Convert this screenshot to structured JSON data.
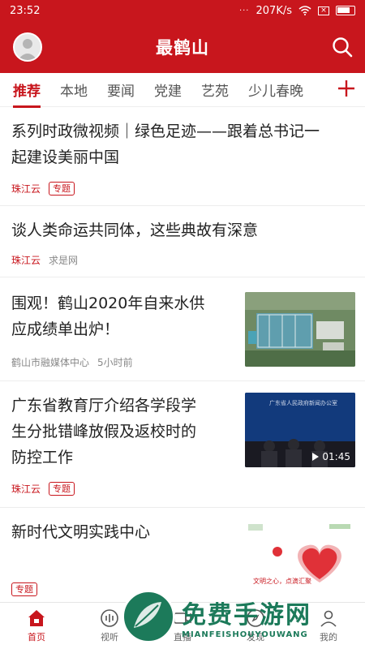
{
  "status_bar": {
    "time": "23:52",
    "dots": "···",
    "speed": "207K/s"
  },
  "header": {
    "title": "最鹤山"
  },
  "tabs": [
    {
      "label": "推荐",
      "active": true
    },
    {
      "label": "本地"
    },
    {
      "label": "要闻"
    },
    {
      "label": "党建"
    },
    {
      "label": "艺苑"
    },
    {
      "label": "少儿春晚"
    }
  ],
  "feed": [
    {
      "title_line1": "系列时政微视频｜绿色足迹——跟着总书记一",
      "title_line2": "起建设美丽中国",
      "source": "珠江云",
      "tag": "专题"
    },
    {
      "title_line1": "谈人类命运共同体，这些典故有深意",
      "source": "珠江云",
      "source2": "求是网"
    },
    {
      "title_line1": "围观！鹤山2020年自来水供",
      "title_line2": "应成绩单出炉！",
      "source": "鹤山市融媒体中心",
      "time": "5小时前"
    },
    {
      "title_line1": "广东省教育厅介绍各学段学",
      "title_line2": "生分批错峰放假及返校时的",
      "title_line3": "防控工作",
      "source": "珠江云",
      "tag": "专题",
      "video_duration": "01:45",
      "thumb_caption": "广东省人民政府新闻办公室"
    },
    {
      "title_line1": "新时代文明实践中心",
      "tag": "专题",
      "thumb_caption": "文明之心，点滴汇聚"
    }
  ],
  "bottom_nav": [
    {
      "label": "首页",
      "icon": "home-icon",
      "active": true
    },
    {
      "label": "视听",
      "icon": "audio-icon"
    },
    {
      "label": "直播",
      "icon": "live-icon"
    },
    {
      "label": "发现",
      "icon": "discover-icon"
    },
    {
      "label": "我的",
      "icon": "profile-icon"
    }
  ],
  "watermark": {
    "main": "免费手游网",
    "sub": "MIANFEISHOUYOUWANG"
  },
  "colors": {
    "brand": "#c8161d",
    "watermark": "#1c7a5a"
  }
}
